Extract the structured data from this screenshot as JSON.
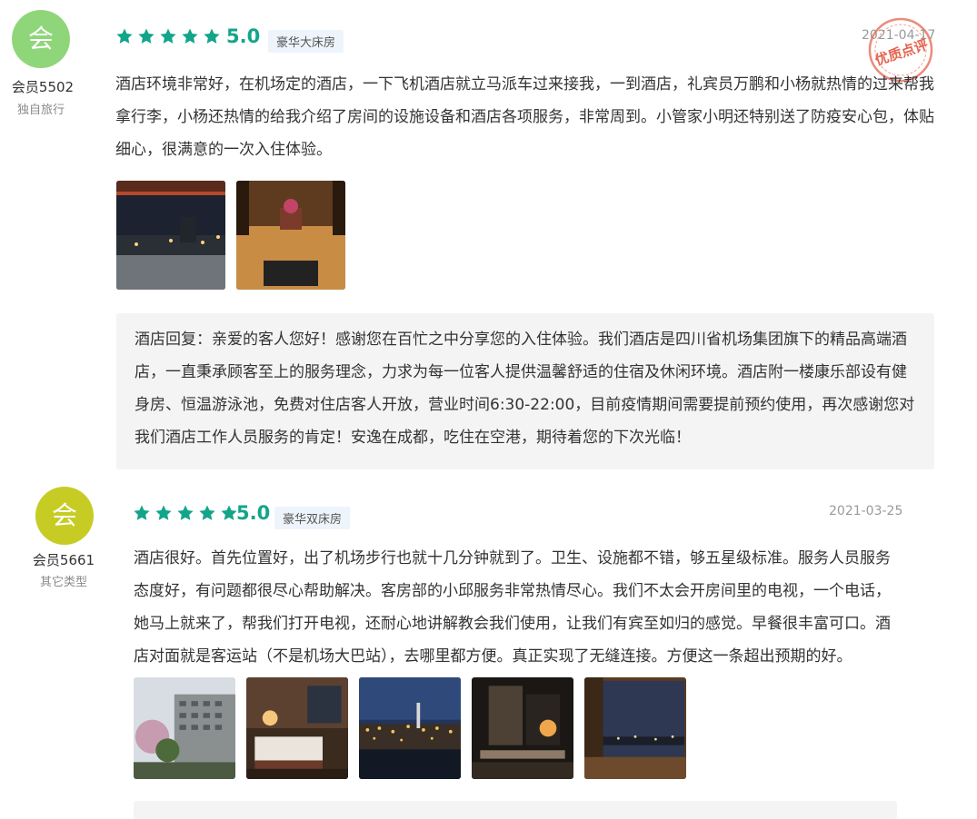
{
  "colors": {
    "accent": "#13a58a",
    "avatar1": "#8fd67a",
    "avatar2": "#c6cc24",
    "stamp": "#e4644f"
  },
  "reviews": [
    {
      "avatar_char": "会",
      "member": "会员5502",
      "trip_type": "独自旅行",
      "score": "5.0",
      "room": "豪华大床房",
      "date": "2021-04-17",
      "stamp_text": "优质点评",
      "text": "酒店环境非常好，在机场定的酒店，一下飞机酒店就立马派车过来接我，一到酒店，礼宾员万鹏和小杨就热情的过来帮我拿行李，小杨还热情的给我介绍了房间的设施设备和酒店各项服务，非常周到。小管家小明还特别送了防疫安心包，体贴细心，很满意的一次入住体验。",
      "photos": [
        "night-courtyard-photo",
        "hotel-lobby-photo"
      ],
      "reply": "酒店回复：亲爱的客人您好！感谢您在百忙之中分享您的入住体验。我们酒店是四川省机场集团旗下的精品高端酒店，一直秉承顾客至上的服务理念，力求为每一位客人提供温馨舒适的住宿及休闲环境。酒店附一楼康乐部设有健身房、恒温游泳池，免费对住店客人开放，营业时间6:30-22:00，目前疫情期间需要提前预约使用，再次感谢您对我们酒店工作人员服务的肯定！安逸在成都，吃住在空港，期待着您的下次光临！"
    },
    {
      "avatar_char": "会",
      "member": "会员5661",
      "trip_type": "其它类型",
      "score": "5.0",
      "room": "豪华双床房",
      "date": "2021-03-25",
      "text": "酒店很好。首先位置好，出了机场步行也就十几分钟就到了。卫生、设施都不错，够五星级标准。服务人员服务态度好，有问题都很尽心帮助解决。客房部的小邱服务非常热情尽心。我们不太会开房间里的电视，一个电话，她马上就来了，帮我们打开电视，还耐心地讲解教会我们使用，让我们有宾至如归的感觉。早餐很丰富可口。酒店对面就是客运站（不是机场大巴站），去哪里都方便。真正实现了无缝连接。方便这一条超出预期的好。",
      "photos": [
        "hotel-exterior-photo",
        "guest-room-photo",
        "night-airport-photo",
        "bathroom-photo",
        "window-view-photo"
      ]
    }
  ]
}
